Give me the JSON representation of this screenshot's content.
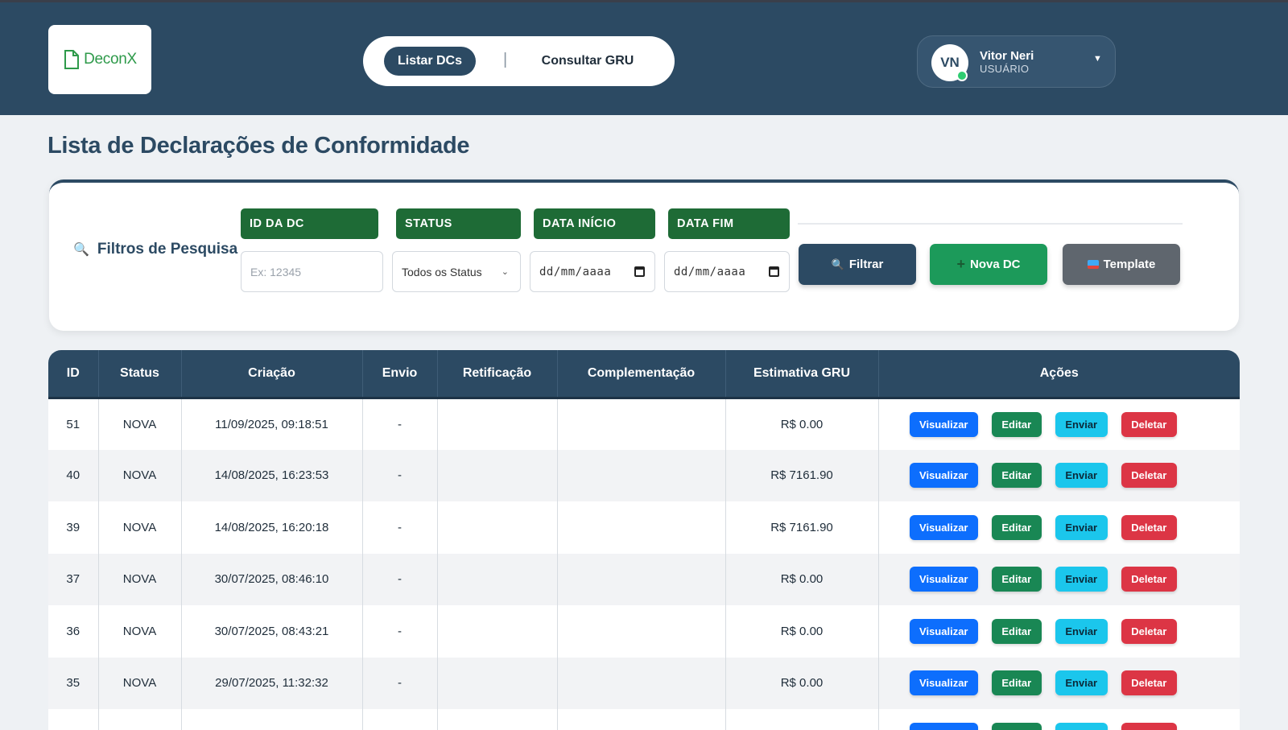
{
  "header": {
    "logo_text": "DeconX",
    "nav": {
      "active": "Listar DCs",
      "separator": "|",
      "other": "Consultar GRU"
    },
    "user": {
      "initials": "VN",
      "name": "Vitor Neri",
      "role": "USUÁRIO"
    }
  },
  "page_title": "Lista de Declarações de Conformidade",
  "filters": {
    "title": "Filtros de Pesquisa",
    "id_label": "ID DA DC",
    "id_placeholder": "Ex: 12345",
    "status_label": "STATUS",
    "status_value": "Todos os Status",
    "start_label": "DATA INÍCIO",
    "start_placeholder": "dd/mm/aaaa",
    "end_label": "DATA FIM",
    "end_placeholder": "dd/mm/aaaa",
    "filter_button": "Filtrar",
    "new_button": "Nova DC",
    "template_button": "Template"
  },
  "table": {
    "columns": [
      "ID",
      "Status",
      "Criação",
      "Envio",
      "Retificação",
      "Complementação",
      "Estimativa GRU",
      "Ações"
    ],
    "action_labels": {
      "view": "Visualizar",
      "edit": "Editar",
      "send": "Enviar",
      "delete": "Deletar"
    },
    "rows": [
      {
        "id": "51",
        "status": "NOVA",
        "created": "11/09/2025, 09:18:51",
        "sent": "-",
        "rectification": "",
        "complement": "",
        "gru": "R$ 0.00"
      },
      {
        "id": "40",
        "status": "NOVA",
        "created": "14/08/2025, 16:23:53",
        "sent": "-",
        "rectification": "",
        "complement": "",
        "gru": "R$ 7161.90"
      },
      {
        "id": "39",
        "status": "NOVA",
        "created": "14/08/2025, 16:20:18",
        "sent": "-",
        "rectification": "",
        "complement": "",
        "gru": "R$ 7161.90"
      },
      {
        "id": "37",
        "status": "NOVA",
        "created": "30/07/2025, 08:46:10",
        "sent": "-",
        "rectification": "",
        "complement": "",
        "gru": "R$ 0.00"
      },
      {
        "id": "36",
        "status": "NOVA",
        "created": "30/07/2025, 08:43:21",
        "sent": "-",
        "rectification": "",
        "complement": "",
        "gru": "R$ 0.00"
      },
      {
        "id": "35",
        "status": "NOVA",
        "created": "29/07/2025, 11:32:32",
        "sent": "-",
        "rectification": "",
        "complement": "",
        "gru": "R$ 0.00"
      },
      {
        "id": "",
        "status": "",
        "created": "",
        "sent": "",
        "rectification": "",
        "complement": "",
        "gru": ""
      }
    ]
  },
  "colors": {
    "header_bg": "#2c4a63",
    "label_green": "#1e6b36",
    "view": "#0d6efd",
    "edit": "#198754",
    "send": "#1bc6ec",
    "delete": "#dc3545"
  }
}
